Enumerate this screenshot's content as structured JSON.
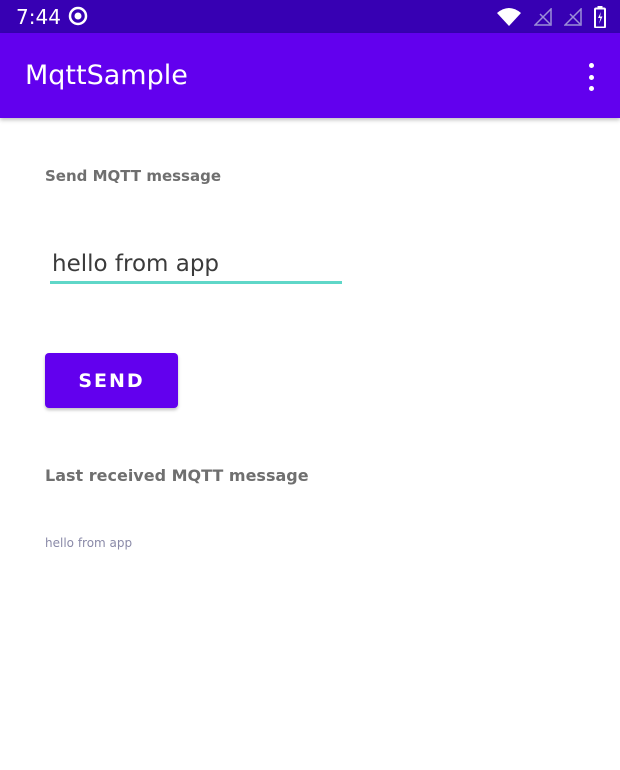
{
  "status_bar": {
    "time": "7:44",
    "icons": [
      "sync-icon",
      "wifi-icon",
      "signal-off-icon",
      "signal-off-icon",
      "battery-icon"
    ]
  },
  "app_bar": {
    "title": "MqttSample",
    "menu_icon": "more-vert-icon"
  },
  "send_section": {
    "label": "Send MQTT message",
    "input_value": "hello from app",
    "button_label": "SEND"
  },
  "receive_section": {
    "label": "Last received MQTT message",
    "message": "hello from app"
  },
  "colors": {
    "status_bar": "#3700b3",
    "primary": "#6200ee",
    "input_underline": "#5fd7c8",
    "label_text": "#6f6f6f",
    "received_text": "#8a8aa8"
  }
}
